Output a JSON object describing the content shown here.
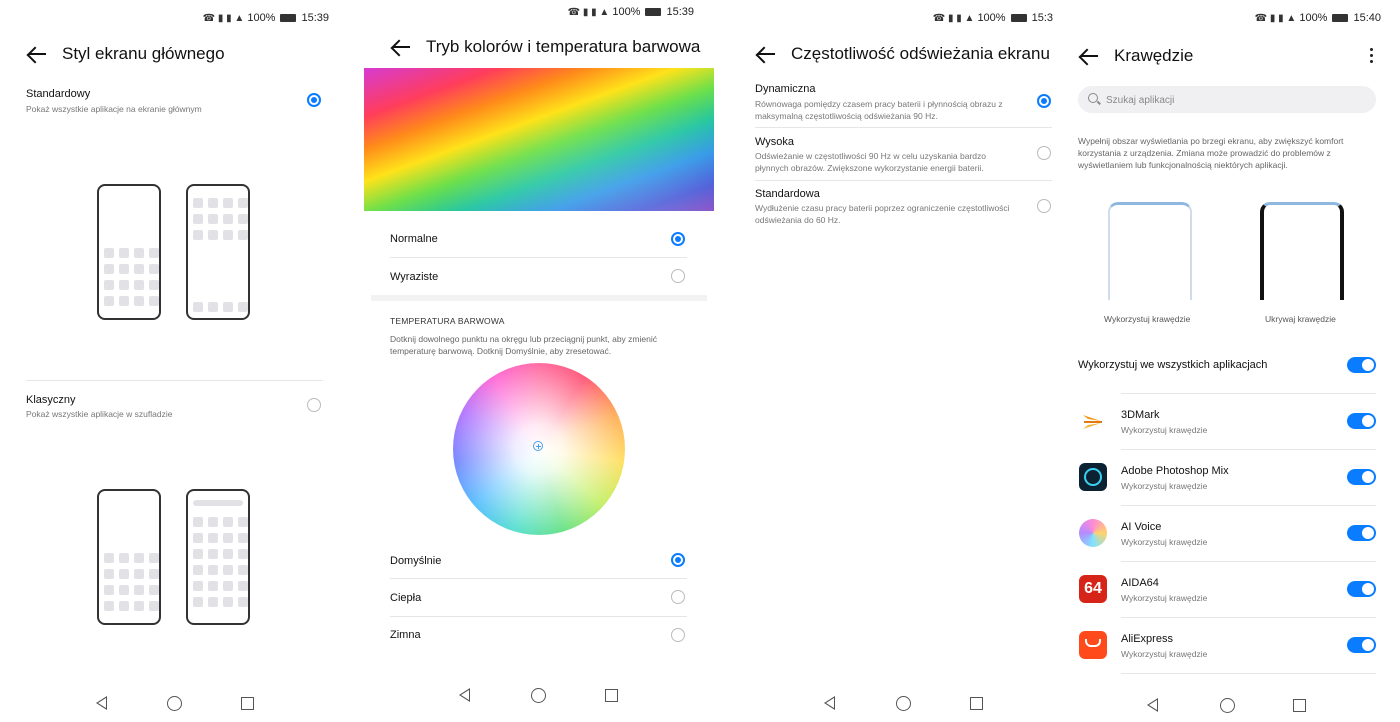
{
  "colors": {
    "accent": "#0a7cff"
  },
  "panels": {
    "home_style": {
      "status": {
        "time": "15:39",
        "battery": "100%"
      },
      "title": "Styl ekranu głównego",
      "options": [
        {
          "title": "Standardowy",
          "subtitle": "Pokaż wszystkie aplikacje na ekranie głównym",
          "selected": true
        },
        {
          "title": "Klasyczny",
          "subtitle": "Pokaż wszystkie aplikacje w szufladzie",
          "selected": false
        }
      ]
    },
    "color_mode": {
      "status": {
        "time": "15:39",
        "battery": "100%"
      },
      "title": "Tryb kolorów i temperatura barwowa",
      "modes": [
        {
          "label": "Normalne",
          "selected": true
        },
        {
          "label": "Wyraziste",
          "selected": false
        }
      ],
      "temp_section_label": "TEMPERATURA BARWOWA",
      "temp_description": "Dotknij dowolnego punktu na okręgu lub przeciągnij punkt, aby zmienić temperaturę barwową. Dotknij Domyślnie, aby zresetować.",
      "temps": [
        {
          "label": "Domyślnie",
          "selected": true
        },
        {
          "label": "Ciepła",
          "selected": false
        },
        {
          "label": "Zimna",
          "selected": false
        }
      ]
    },
    "refresh_rate": {
      "status": {
        "time": "15:3",
        "battery": "100%"
      },
      "title": "Częstotliwość odświeżania ekranu",
      "options": [
        {
          "title": "Dynamiczna",
          "subtitle": "Równowaga pomiędzy czasem pracy baterii i płynnością obrazu z maksymalną częstotliwością odświeżania 90 Hz.",
          "selected": true
        },
        {
          "title": "Wysoka",
          "subtitle": "Odświeżanie w częstotliwości 90 Hz w celu uzyskania bardzo płynnych obrazów. Zwiększone wykorzystanie energii baterii.",
          "selected": false
        },
        {
          "title": "Standardowa",
          "subtitle": "Wydłużenie czasu pracy baterii poprzez ograniczenie częstotliwości odświeżania do 60 Hz.",
          "selected": false
        }
      ]
    },
    "edges": {
      "status": {
        "time": "15:40",
        "battery": "100%"
      },
      "title": "Krawędzie",
      "search_placeholder": "Szukaj aplikacji",
      "description": "Wypełnij obszar wyświetlania po brzegi ekranu, aby zwiększyć komfort korzystania z urządzenia. Zmiana może prowadzić do problemów z wyświetlaniem lub funkcjonalnością niektórych aplikacji.",
      "preview_use_label": "Wykorzystuj krawędzie",
      "preview_hide_label": "Ukrywaj krawędzie",
      "all_apps_label": "Wykorzystuj we wszystkich aplikacjach",
      "all_apps_on": true,
      "apps": [
        {
          "name": "3DMark",
          "status": "Wykorzystuj krawędzie",
          "icon": "3dmark-icon",
          "on": true
        },
        {
          "name": "Adobe Photoshop Mix",
          "status": "Wykorzystuj krawędzie",
          "icon": "photoshop-mix-icon",
          "on": true
        },
        {
          "name": "AI Voice",
          "status": "Wykorzystuj krawędzie",
          "icon": "ai-voice-icon",
          "on": true
        },
        {
          "name": "AIDA64",
          "status": "Wykorzystuj krawędzie",
          "icon": "aida64-icon",
          "icon_text": "64",
          "on": true
        },
        {
          "name": "AliExpress",
          "status": "Wykorzystuj krawędzie",
          "icon": "aliexpress-icon",
          "on": true
        }
      ]
    }
  }
}
